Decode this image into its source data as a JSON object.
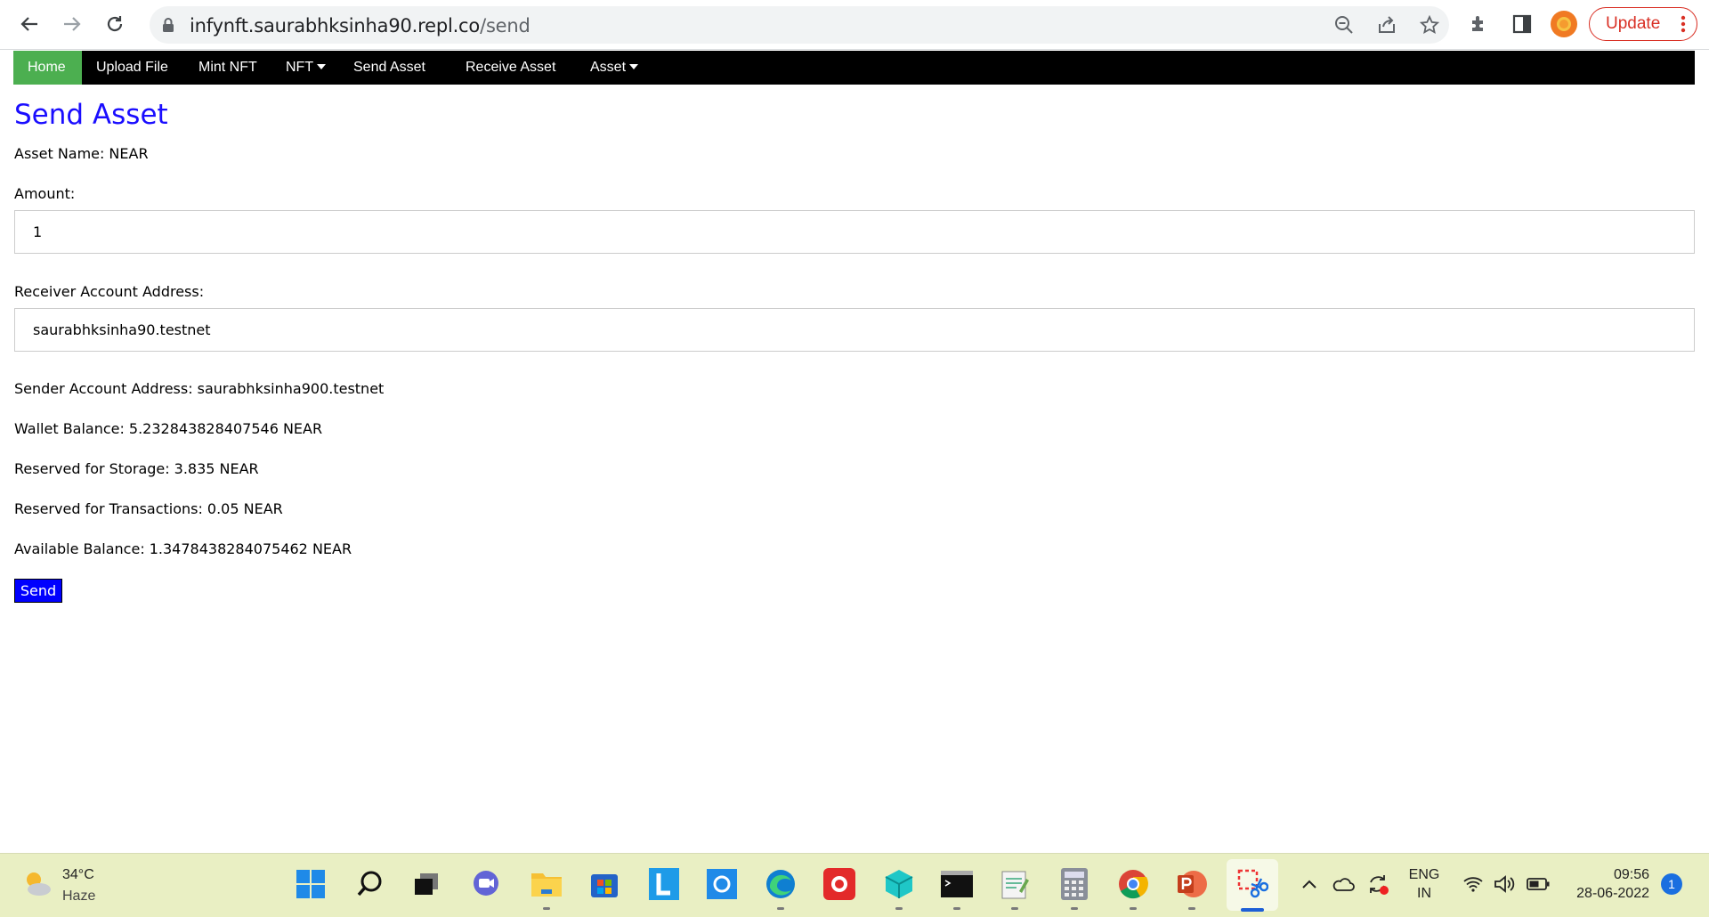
{
  "browser": {
    "url_host": "infynft.saurabhksinha90.repl.co",
    "url_path": "/send",
    "update_label": "Update"
  },
  "navbar": {
    "items": [
      {
        "label": "Home"
      },
      {
        "label": "Upload File"
      },
      {
        "label": "Mint NFT"
      },
      {
        "label": "NFT"
      },
      {
        "label": "Send Asset"
      },
      {
        "label": "Receive Asset"
      },
      {
        "label": "Asset"
      }
    ]
  },
  "page": {
    "title": "Send Asset",
    "asset_name_label": "Asset Name:",
    "asset_name_value": "NEAR",
    "amount_label": "Amount:",
    "amount_value": "1",
    "receiver_label": "Receiver Account Address:",
    "receiver_value": "saurabhksinha90.testnet",
    "sender_label": "Sender Account Address:",
    "sender_value": "saurabhksinha900.testnet",
    "wallet_balance_label": "Wallet Balance:",
    "wallet_balance_value": "5.232843828407546 NEAR",
    "reserved_storage_label": "Reserved for Storage:",
    "reserved_storage_value": "3.835 NEAR",
    "reserved_tx_label": "Reserved for Transactions:",
    "reserved_tx_value": "0.05 NEAR",
    "available_label": "Available Balance:",
    "available_value": "1.3478438284075462 NEAR",
    "send_label": "Send"
  },
  "taskbar": {
    "temperature": "34°C",
    "weather": "Haze",
    "lang_top": "ENG",
    "lang_bottom": "IN",
    "time": "09:56",
    "date": "28-06-2022",
    "notification_count": "1"
  }
}
